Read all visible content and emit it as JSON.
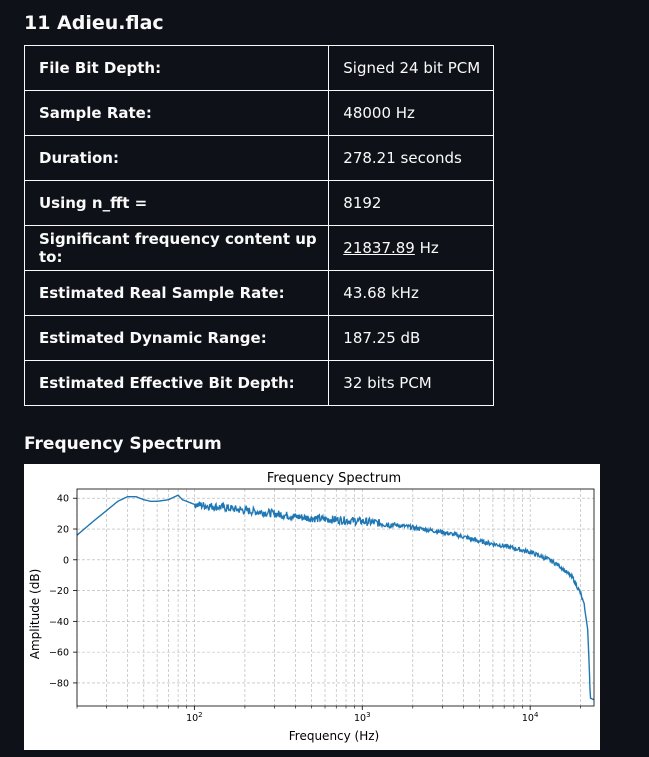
{
  "file": {
    "title": "11 Adieu.flac"
  },
  "info_rows": [
    {
      "label": "File Bit Depth:",
      "value": "Signed 24 bit PCM"
    },
    {
      "label": "Sample Rate:",
      "value": "48000 Hz"
    },
    {
      "label": "Duration:",
      "value": "278.21 seconds"
    },
    {
      "label": "Using n_fft =",
      "value": "8192"
    },
    {
      "label": "Significant frequency content up to:",
      "value_link": "21837.89",
      "value_suffix": " Hz"
    },
    {
      "label": "Estimated Real Sample Rate:",
      "value": "43.68 kHz"
    },
    {
      "label": "Estimated Dynamic Range:",
      "value": "187.25 dB"
    },
    {
      "label": "Estimated Effective Bit Depth:",
      "value": "32 bits PCM"
    }
  ],
  "section": {
    "title": "Frequency Spectrum"
  },
  "chart_data": {
    "type": "line",
    "title": "Frequency Spectrum",
    "xlabel": "Frequency (Hz)",
    "ylabel": "Amplitude (dB)",
    "x_scale": "log",
    "xlim": [
      20,
      24000
    ],
    "ylim": [
      -95,
      46
    ],
    "x_ticks": [
      {
        "value": 100,
        "base": "10",
        "exp": "2"
      },
      {
        "value": 1000,
        "base": "10",
        "exp": "3"
      },
      {
        "value": 10000,
        "base": "10",
        "exp": "4"
      }
    ],
    "y_ticks": [
      40,
      20,
      0,
      -20,
      -40,
      -60,
      -80
    ],
    "y_tick_labels": [
      "40",
      "20",
      "0",
      "−20",
      "−40",
      "−60",
      "−80"
    ],
    "grid": true,
    "line_color": "#1f77b4",
    "series": [
      {
        "x": [
          20,
          25,
          30,
          35,
          40,
          45,
          50,
          55,
          60,
          70,
          80,
          85,
          90,
          100,
          120,
          150,
          200,
          250,
          300,
          400,
          500,
          700,
          1000,
          1500,
          2000,
          3000,
          4000,
          5000,
          7000,
          10000,
          13000,
          15000,
          18000,
          20000,
          21000,
          22000,
          22500,
          22800,
          23000,
          24000
        ],
        "y": [
          16,
          25,
          32,
          38,
          41,
          41,
          39,
          38,
          38,
          39,
          42,
          39,
          38,
          36,
          35,
          34,
          32,
          31,
          30,
          28,
          27,
          26,
          25,
          23,
          21,
          18,
          15,
          12,
          9,
          5,
          0,
          -4,
          -12,
          -22,
          -30,
          -45,
          -70,
          -90,
          -90,
          -91
        ]
      }
    ]
  }
}
